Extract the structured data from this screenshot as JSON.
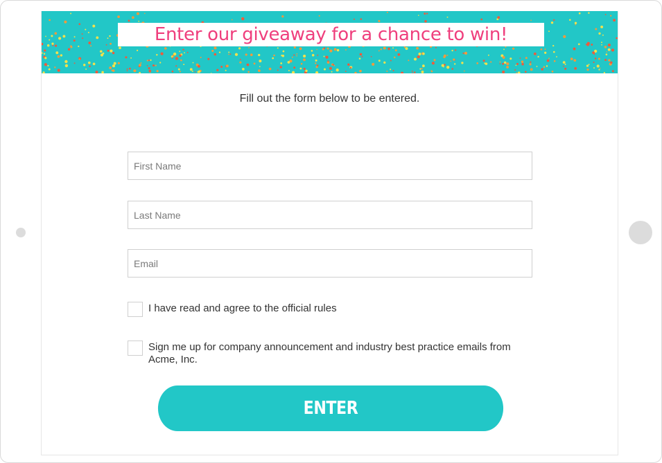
{
  "banner": {
    "title": "Enter our giveaway for a chance to win!",
    "background_color": "#22c7c7",
    "title_color": "#ef3f7d",
    "confetti_colors": [
      "#f2e14c",
      "#ef5a3c",
      "#f29a3c"
    ]
  },
  "form": {
    "intro": "Fill out the form below to be entered.",
    "first_name_placeholder": "First Name",
    "last_name_placeholder": "Last Name",
    "email_placeholder": "Email",
    "rules_checkbox_label": "I have read and agree to the official rules",
    "newsletter_checkbox_label": "Sign me up for company announcement and industry best practice emails from Acme, Inc.",
    "submit_label": "ENTER"
  }
}
